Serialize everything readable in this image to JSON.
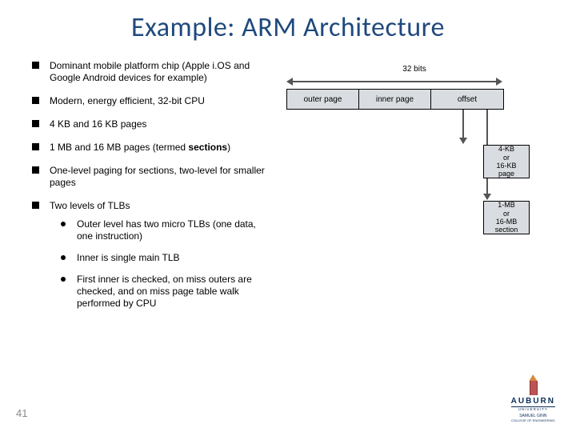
{
  "title": "Example: ARM Architecture",
  "bullets": {
    "b1": "Dominant mobile platform chip (Apple i.OS and Google Android devices for example)",
    "b2": "Modern, energy efficient, 32-bit CPU",
    "b3": "4 KB and 16 KB pages",
    "b4_a": "1 MB and 16 MB pages (termed ",
    "b4_b": "sections",
    "b4_c": ")",
    "b5": "One-level paging for sections, two-level for smaller pages",
    "b6": "Two levels of TLBs",
    "sub1": "Outer level has two micro TLBs (one data, one instruction)",
    "sub2": "Inner is single main TLB",
    "sub3": "First inner is checked, on miss outers are checked, and on miss page table walk performed by CPU"
  },
  "diagram": {
    "bits_label": "32 bits",
    "seg_outer": "outer page",
    "seg_inner": "inner page",
    "seg_offset": "offset",
    "box1_l1": "4-KB",
    "box1_l2": "or",
    "box1_l3": "16-KB",
    "box1_l4": "page",
    "box2_l1": "1-MB",
    "box2_l2": "or",
    "box2_l3": "16-MB",
    "box2_l4": "section"
  },
  "footer": {
    "page_num": "41",
    "logo_name": "AUBURN",
    "logo_sub1": "UNIVERSITY",
    "logo_sub2": "SAMUEL GINN",
    "logo_sub3": "COLLEGE OF ENGINEERING"
  }
}
